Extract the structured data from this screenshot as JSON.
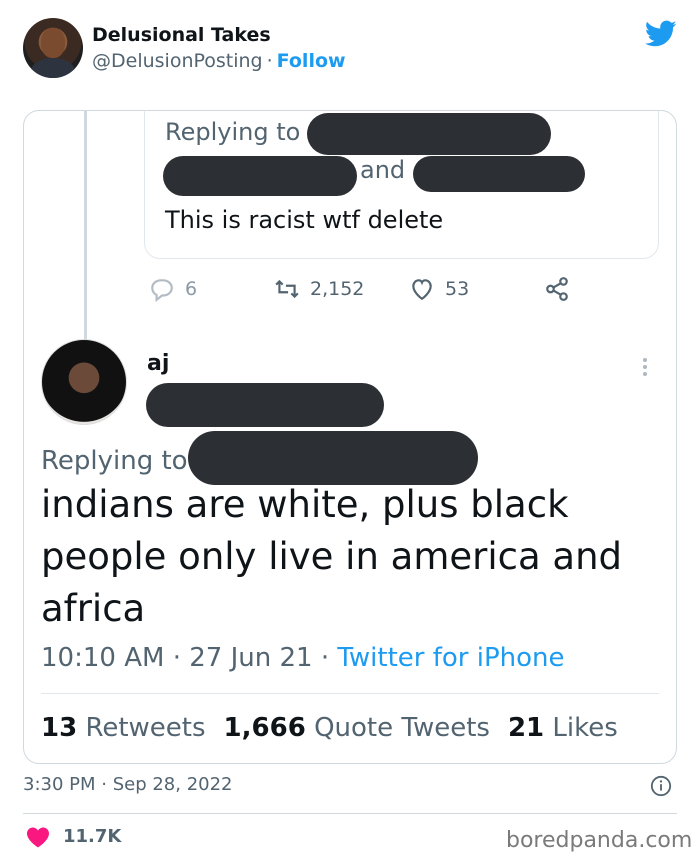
{
  "embed": {
    "display_name": "Delusional Takes",
    "handle": "@DelusionPosting",
    "separator": "·",
    "follow_label": "Follow",
    "brand_color": "#1d9bf0",
    "icons": [
      "twitter-bird-icon",
      "info-icon",
      "heart-icon"
    ]
  },
  "quoted": {
    "replying_label": "Replying to",
    "and_label": "and",
    "text": "This is racist wtf delete",
    "actions": {
      "replies": "6",
      "retweets": "2,152",
      "likes": "53"
    }
  },
  "reply": {
    "name": "aj",
    "replying_label": "Replying to",
    "text": "indians are white, plus black people only live in america and africa",
    "time": "10:10 AM",
    "date": "27 Jun 21",
    "separator": "·",
    "source": "Twitter for iPhone",
    "stats": {
      "retweets_count": "13",
      "retweets_label": "Retweets",
      "quotes_count": "1,666",
      "quotes_label": "Quote Tweets",
      "likes_count": "21",
      "likes_label": "Likes"
    }
  },
  "footer": {
    "timestamp": "3:30 PM · Sep 28, 2022",
    "likes": "11.7K",
    "watermark": "boredpanda.com",
    "heart_color": "#f91880"
  }
}
